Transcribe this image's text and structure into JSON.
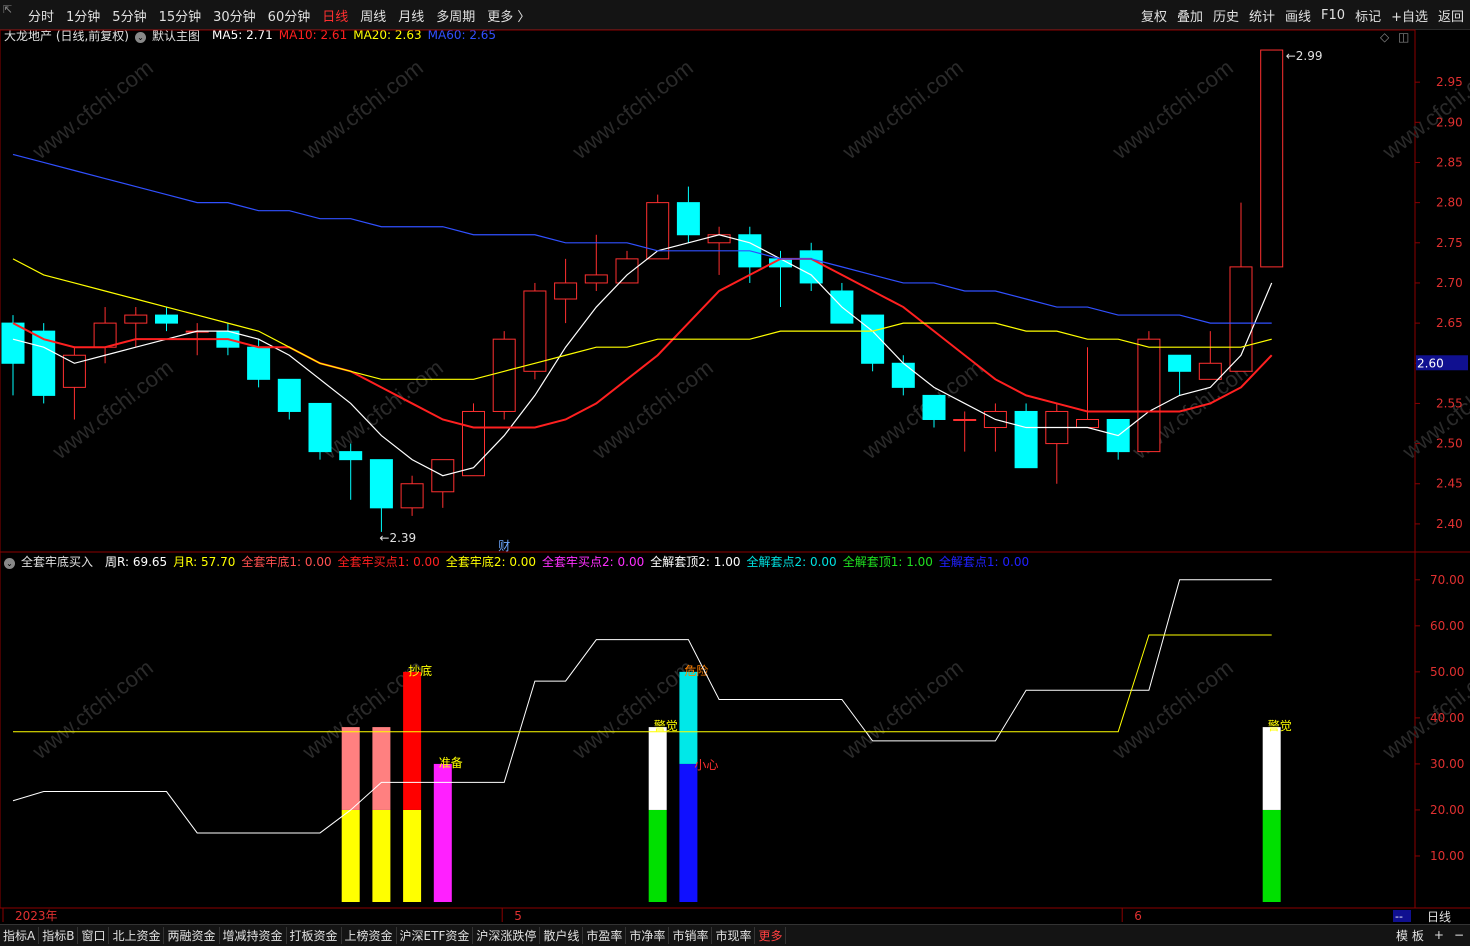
{
  "toolbar": {
    "corner_icon": "restore-icon",
    "periods": [
      "分时",
      "1分钟",
      "5分钟",
      "15分钟",
      "30分钟",
      "60分钟",
      "日线",
      "周线",
      "月线",
      "多周期",
      "更多 〉"
    ],
    "active_period": "日线",
    "tools": [
      "复权",
      "叠加",
      "历史",
      "统计",
      "画线",
      "F10",
      "标记",
      "+自选",
      "返回"
    ]
  },
  "main_info": {
    "stock": "大龙地产 (日线,前复权)",
    "template": "默认主图",
    "ma": [
      {
        "label": "MA5: 2.71",
        "color": "#ffffff"
      },
      {
        "label": "MA10: 2.61",
        "color": "#ff2020"
      },
      {
        "label": "MA20: 2.63",
        "color": "#ffff00"
      },
      {
        "label": "MA60: 2.65",
        "color": "#3050ff"
      }
    ]
  },
  "indicator_info": {
    "name": "全套牢底买入",
    "items": [
      {
        "label": "周R: 69.65",
        "color": "#ffffff"
      },
      {
        "label": "月R: 57.70",
        "color": "#ffff00"
      },
      {
        "label": "全套牢底1: 0.00",
        "color": "#ff5050"
      },
      {
        "label": "全套牢买点1: 0.00",
        "color": "#ff2020"
      },
      {
        "label": "全套牢底2: 0.00",
        "color": "#ffff00"
      },
      {
        "label": "全套牢买点2: 0.00",
        "color": "#ff30ff"
      },
      {
        "label": "全解套顶2: 1.00",
        "color": "#ffffff"
      },
      {
        "label": "全解套点2: 0.00",
        "color": "#00e0e0"
      },
      {
        "label": "全解套顶1: 1.00",
        "color": "#20e020"
      },
      {
        "label": "全解套点1: 0.00",
        "color": "#2020ff"
      }
    ]
  },
  "price_axis": [
    "2.95",
    "2.90",
    "2.85",
    "2.80",
    "2.75",
    "2.70",
    "2.65",
    "2.60",
    "2.55",
    "2.50",
    "2.45",
    "2.40"
  ],
  "indicator_axis": [
    "70.00",
    "60.00",
    "50.00",
    "40.00",
    "30.00",
    "20.00",
    "10.00"
  ],
  "current_price": "2.60",
  "high_label": "2.99",
  "low_label": "2.39",
  "finance_marker": "财",
  "date_labels": [
    "2023年",
    "5",
    "6"
  ],
  "period_label": "日线",
  "scroll_label": "--",
  "bottom_tabs": [
    "指标A",
    "指标B",
    "窗口",
    "北上资金",
    "两融资金",
    "增减持资金",
    "打板资金",
    "上榜资金",
    "沪深ETF资金",
    "沪深涨跌停",
    "散户线",
    "市盈率",
    "市净率",
    "市销率",
    "市现率",
    "更多"
  ],
  "bottom_right": [
    "模 板",
    "+",
    "−"
  ],
  "watermark": "www.cfchi.com",
  "chart_data": [
    {
      "type": "candlestick",
      "title": "大龙地产 (日线,前复权)",
      "ylim": [
        2.37,
        3.0
      ],
      "candles": [
        [
          2.65,
          2.6,
          2.66,
          2.56
        ],
        [
          2.64,
          2.56,
          2.65,
          2.55
        ],
        [
          2.57,
          2.61,
          2.62,
          2.53
        ],
        [
          2.62,
          2.65,
          2.67,
          2.6
        ],
        [
          2.65,
          2.66,
          2.67,
          2.62
        ],
        [
          2.66,
          2.65,
          2.67,
          2.64
        ],
        [
          2.64,
          2.64,
          2.65,
          2.61
        ],
        [
          2.64,
          2.62,
          2.65,
          2.61
        ],
        [
          2.62,
          2.58,
          2.63,
          2.57
        ],
        [
          2.58,
          2.54,
          2.58,
          2.53
        ],
        [
          2.55,
          2.49,
          2.55,
          2.48
        ],
        [
          2.49,
          2.48,
          2.5,
          2.43
        ],
        [
          2.48,
          2.42,
          2.48,
          2.39
        ],
        [
          2.42,
          2.45,
          2.46,
          2.41
        ],
        [
          2.44,
          2.48,
          2.47,
          2.42
        ],
        [
          2.46,
          2.54,
          2.55,
          2.46
        ],
        [
          2.54,
          2.63,
          2.64,
          2.53
        ],
        [
          2.59,
          2.69,
          2.7,
          2.58
        ],
        [
          2.68,
          2.7,
          2.73,
          2.65
        ],
        [
          2.7,
          2.71,
          2.76,
          2.69
        ],
        [
          2.7,
          2.73,
          2.74,
          2.7
        ],
        [
          2.73,
          2.8,
          2.81,
          2.73
        ],
        [
          2.8,
          2.76,
          2.82,
          2.75
        ],
        [
          2.75,
          2.76,
          2.77,
          2.71
        ],
        [
          2.76,
          2.72,
          2.77,
          2.7
        ],
        [
          2.73,
          2.72,
          2.74,
          2.67
        ],
        [
          2.74,
          2.7,
          2.75,
          2.69
        ],
        [
          2.69,
          2.65,
          2.7,
          2.65
        ],
        [
          2.66,
          2.6,
          2.66,
          2.59
        ],
        [
          2.6,
          2.57,
          2.61,
          2.56
        ],
        [
          2.56,
          2.53,
          2.56,
          2.52
        ],
        [
          2.53,
          2.53,
          2.54,
          2.49
        ],
        [
          2.52,
          2.54,
          2.55,
          2.49
        ],
        [
          2.54,
          2.47,
          2.55,
          2.47
        ],
        [
          2.5,
          2.54,
          2.55,
          2.45
        ],
        [
          2.52,
          2.53,
          2.62,
          2.52
        ],
        [
          2.53,
          2.49,
          2.53,
          2.48
        ],
        [
          2.49,
          2.63,
          2.64,
          2.49
        ],
        [
          2.61,
          2.59,
          2.61,
          2.56
        ],
        [
          2.58,
          2.6,
          2.64,
          2.58
        ],
        [
          2.59,
          2.72,
          2.8,
          2.59
        ],
        [
          2.72,
          2.99,
          2.99,
          2.72
        ]
      ],
      "series": [
        {
          "name": "MA5",
          "color": "#ffffff",
          "values": [
            2.63,
            2.62,
            2.6,
            2.61,
            2.62,
            2.63,
            2.64,
            2.64,
            2.63,
            2.61,
            2.58,
            2.55,
            2.51,
            2.48,
            2.46,
            2.47,
            2.51,
            2.56,
            2.62,
            2.67,
            2.71,
            2.74,
            2.75,
            2.76,
            2.75,
            2.73,
            2.71,
            2.67,
            2.64,
            2.6,
            2.57,
            2.55,
            2.53,
            2.52,
            2.52,
            2.52,
            2.51,
            2.54,
            2.56,
            2.57,
            2.61,
            2.7
          ]
        },
        {
          "name": "MA10",
          "color": "#ff2020",
          "values": [
            2.65,
            2.63,
            2.62,
            2.62,
            2.63,
            2.63,
            2.63,
            2.63,
            2.62,
            2.62,
            2.6,
            2.59,
            2.57,
            2.55,
            2.53,
            2.52,
            2.52,
            2.52,
            2.53,
            2.55,
            2.58,
            2.61,
            2.65,
            2.69,
            2.71,
            2.73,
            2.73,
            2.71,
            2.69,
            2.67,
            2.64,
            2.61,
            2.58,
            2.56,
            2.55,
            2.54,
            2.54,
            2.54,
            2.54,
            2.55,
            2.57,
            2.61
          ]
        },
        {
          "name": "MA20",
          "color": "#ffff00",
          "values": [
            2.73,
            2.71,
            2.7,
            2.69,
            2.68,
            2.67,
            2.66,
            2.65,
            2.64,
            2.62,
            2.6,
            2.59,
            2.58,
            2.58,
            2.58,
            2.58,
            2.59,
            2.6,
            2.61,
            2.62,
            2.62,
            2.63,
            2.63,
            2.63,
            2.63,
            2.64,
            2.64,
            2.64,
            2.64,
            2.65,
            2.65,
            2.65,
            2.65,
            2.64,
            2.64,
            2.63,
            2.63,
            2.62,
            2.62,
            2.62,
            2.62,
            2.63
          ]
        },
        {
          "name": "MA60",
          "color": "#3050ff",
          "values": [
            2.86,
            2.85,
            2.84,
            2.83,
            2.82,
            2.81,
            2.8,
            2.8,
            2.79,
            2.79,
            2.78,
            2.78,
            2.77,
            2.77,
            2.77,
            2.76,
            2.76,
            2.76,
            2.75,
            2.75,
            2.75,
            2.74,
            2.74,
            2.74,
            2.74,
            2.73,
            2.73,
            2.72,
            2.71,
            2.7,
            2.7,
            2.69,
            2.69,
            2.68,
            2.67,
            2.67,
            2.66,
            2.66,
            2.66,
            2.65,
            2.65,
            2.65
          ]
        }
      ]
    },
    {
      "type": "bar",
      "title": "全套牢底买入",
      "ylim": [
        0,
        73
      ],
      "lines": [
        {
          "name": "周R",
          "color": "#ffffff",
          "values": [
            22,
            24,
            24,
            24,
            24,
            24,
            15,
            15,
            15,
            15,
            15,
            20,
            26,
            26,
            26,
            26,
            26,
            48,
            48,
            57,
            57,
            57,
            57,
            44,
            44,
            44,
            44,
            44,
            35,
            35,
            35,
            35,
            35,
            46,
            46,
            46,
            46,
            46,
            70,
            70,
            70,
            70
          ]
        },
        {
          "name": "月R",
          "color": "#ffff00",
          "values": [
            37,
            37,
            37,
            37,
            37,
            37,
            37,
            37,
            37,
            37,
            37,
            37,
            37,
            37,
            37,
            37,
            37,
            37,
            37,
            37,
            37,
            37,
            37,
            37,
            37,
            37,
            37,
            37,
            37,
            37,
            37,
            37,
            37,
            37,
            37,
            37,
            37,
            58,
            58,
            58,
            58,
            58
          ]
        }
      ],
      "bars": [
        {
          "index": 11,
          "segments": [
            {
              "from": 0,
              "to": 20,
              "color": "#ffff00"
            },
            {
              "from": 20,
              "to": 38,
              "color": "#ff8080"
            }
          ]
        },
        {
          "index": 12,
          "segments": [
            {
              "from": 0,
              "to": 20,
              "color": "#ffff00"
            },
            {
              "from": 20,
              "to": 38,
              "color": "#ff8080"
            }
          ]
        },
        {
          "index": 13,
          "segments": [
            {
              "from": 0,
              "to": 20,
              "color": "#ffff00"
            },
            {
              "from": 20,
              "to": 50,
              "color": "#ff0000"
            }
          ],
          "label": "抄底",
          "label_color": "#ffff00"
        },
        {
          "index": 14,
          "segments": [
            {
              "from": 0,
              "to": 30,
              "color": "#ff20ff"
            }
          ],
          "label": "准备",
          "label_color": "#ffff00"
        },
        {
          "index": 21,
          "segments": [
            {
              "from": 0,
              "to": 20,
              "color": "#00e000"
            },
            {
              "from": 20,
              "to": 38,
              "color": "#ffffff"
            }
          ],
          "label": "警觉",
          "label_color": "#ffff00"
        },
        {
          "index": 22,
          "segments": [
            {
              "from": 0,
              "to": 30,
              "color": "#1010ff"
            },
            {
              "from": 30,
              "to": 50,
              "color": "#00e8e8"
            }
          ],
          "label": "危险",
          "label_color": "#ff8000",
          "label2": "小心",
          "label2_color": "#ff3030"
        },
        {
          "index": 41,
          "segments": [
            {
              "from": 0,
              "to": 20,
              "color": "#00e000"
            },
            {
              "from": 20,
              "to": 38,
              "color": "#ffffff"
            }
          ],
          "label": "警觉",
          "label_color": "#ffff00"
        }
      ]
    }
  ]
}
